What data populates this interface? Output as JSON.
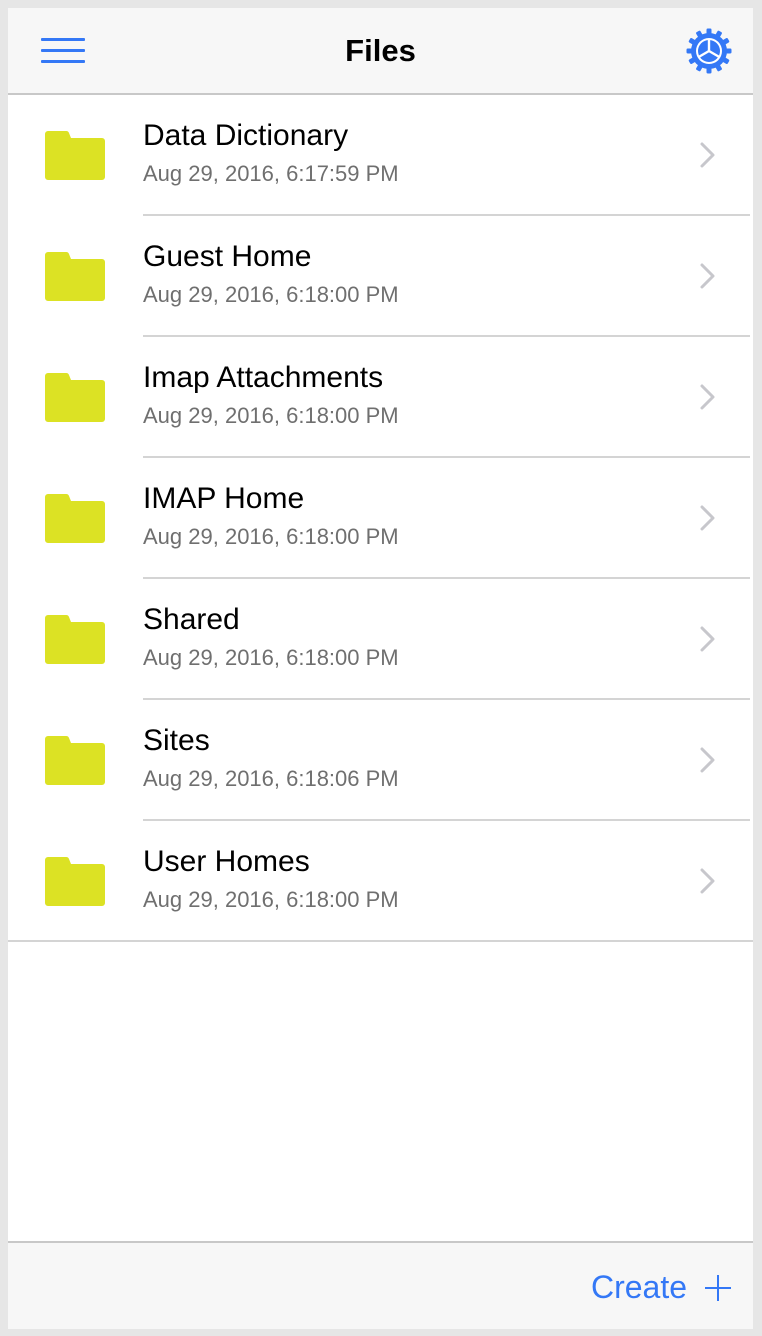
{
  "header": {
    "title": "Files",
    "menu_icon": "hamburger-menu-icon",
    "settings_icon": "gear-icon"
  },
  "colors": {
    "accent": "#3478f6",
    "folder": "#dce224",
    "chevron": "#c7c7cc"
  },
  "files": [
    {
      "name": "Data Dictionary",
      "date": "Aug 29, 2016, 6:17:59 PM",
      "icon": "folder-icon"
    },
    {
      "name": "Guest Home",
      "date": "Aug 29, 2016, 6:18:00 PM",
      "icon": "folder-icon"
    },
    {
      "name": "Imap Attachments",
      "date": "Aug 29, 2016, 6:18:00 PM",
      "icon": "folder-icon"
    },
    {
      "name": "IMAP Home",
      "date": "Aug 29, 2016, 6:18:00 PM",
      "icon": "folder-icon"
    },
    {
      "name": "Shared",
      "date": "Aug 29, 2016, 6:18:00 PM",
      "icon": "folder-icon"
    },
    {
      "name": "Sites",
      "date": "Aug 29, 2016, 6:18:06 PM",
      "icon": "folder-icon"
    },
    {
      "name": "User Homes",
      "date": "Aug 29, 2016, 6:18:00 PM",
      "icon": "folder-icon"
    }
  ],
  "footer": {
    "create_label": "Create",
    "create_icon": "plus-icon"
  }
}
